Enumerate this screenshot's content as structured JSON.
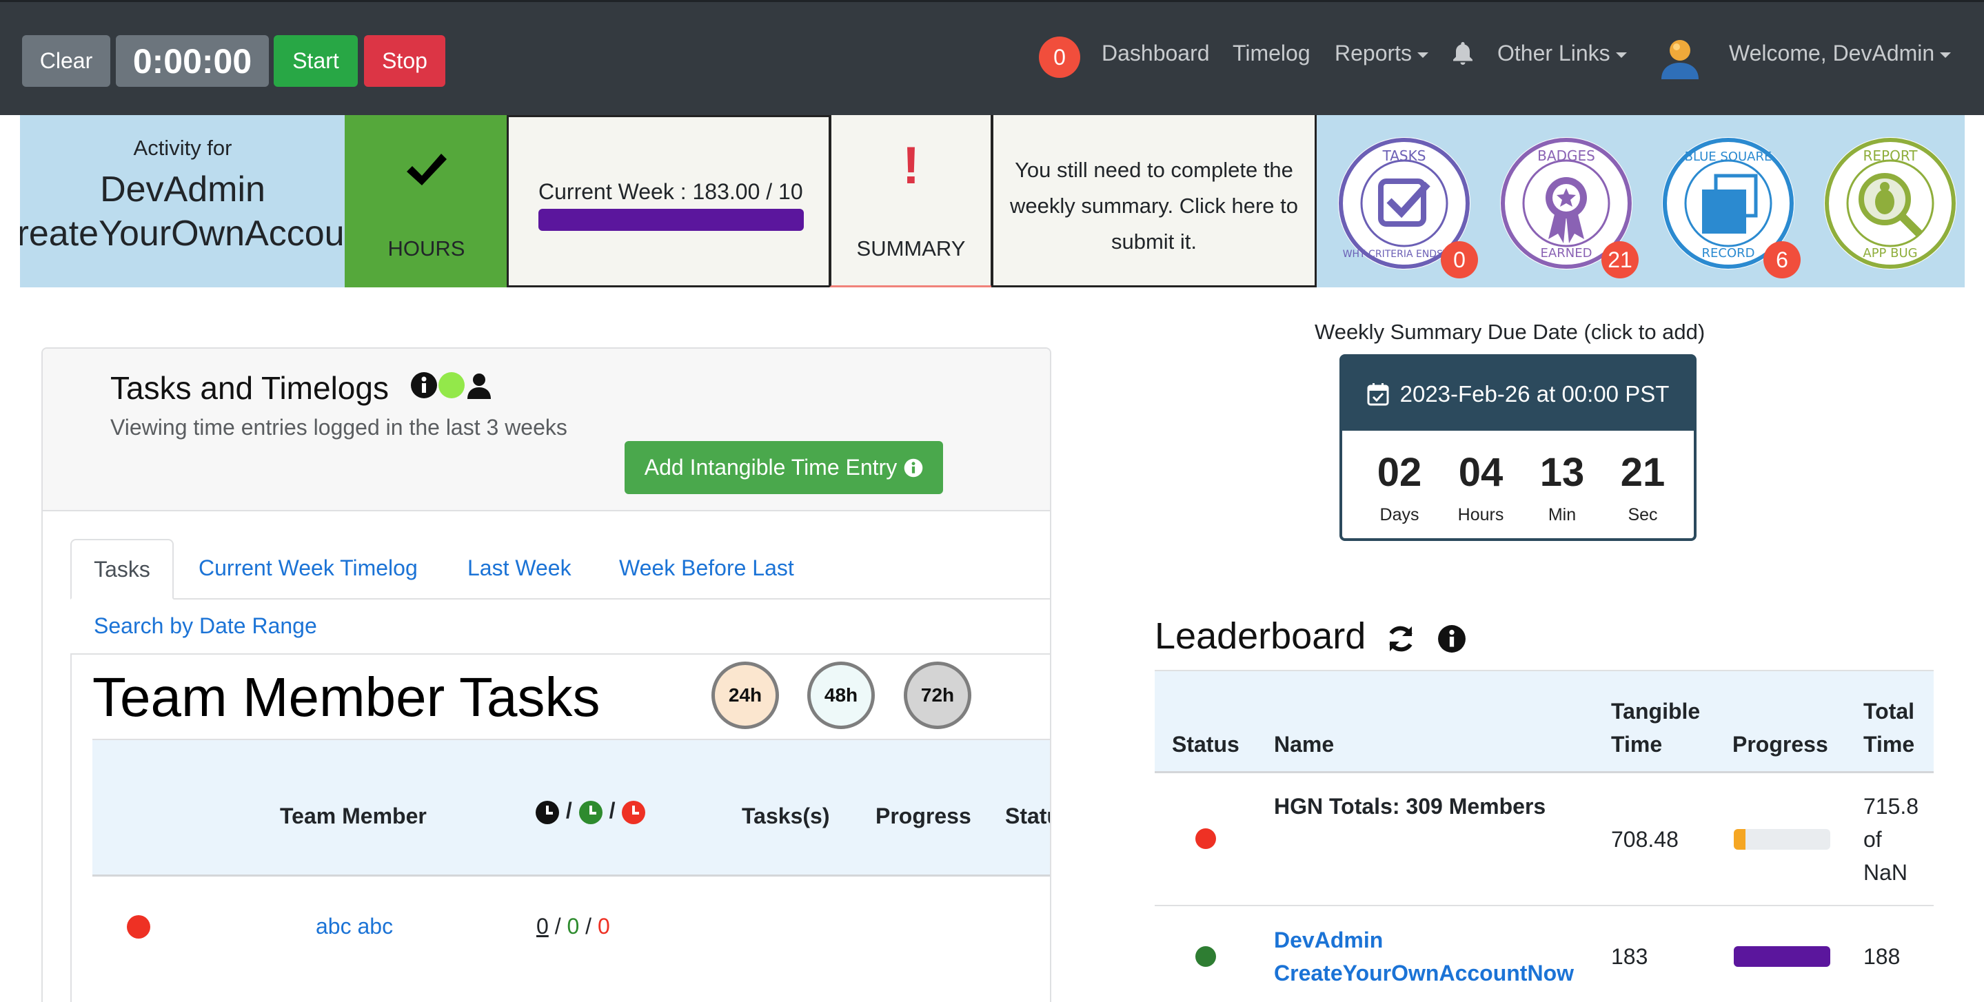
{
  "navbar": {
    "clear_label": "Clear",
    "timer": "0:00:00",
    "start_label": "Start",
    "stop_label": "Stop",
    "notification_count": "0",
    "links": {
      "dashboard": "Dashboard",
      "timelog": "Timelog",
      "reports": "Reports",
      "other_links": "Other Links",
      "welcome": "Welcome, DevAdmin"
    }
  },
  "activity": {
    "label": "Activity for",
    "name_line1": "DevAdmin",
    "name_line2": "CreateYourOwnAccount",
    "hours_label": "HOURS",
    "current_week": "Current Week : 183.00 / 10",
    "summary_label": "SUMMARY",
    "summary_message": "You still need to complete the weekly summary. Click here to submit it."
  },
  "badges": [
    {
      "top_text": "TASKS",
      "bottom_text": "WHY CRITERIA ENDSTATE",
      "count": "0",
      "color": "#6b5fb5"
    },
    {
      "top_text": "BADGES",
      "bottom_text": "EARNED",
      "count": "21",
      "color": "#8a62b4"
    },
    {
      "top_text": "BLUE SQUARE",
      "bottom_text": "RECORD",
      "count": "6",
      "color": "#2b8ad0"
    },
    {
      "top_text": "REPORT",
      "bottom_text": "APP BUG",
      "count": "",
      "color": "#8fae3c"
    }
  ],
  "tasks": {
    "title": "Tasks and Timelogs",
    "subtitle": "Viewing time entries logged in the last 3 weeks",
    "add_button": "Add Intangible Time Entry",
    "tabs": [
      "Tasks",
      "Current Week Timelog",
      "Last Week",
      "Week Before Last",
      "Search by Date Range"
    ],
    "team_title": "Team Member Tasks",
    "time_filters": [
      "24h",
      "48h",
      "72h"
    ],
    "columns": [
      "Team Member",
      "Tasks(s)",
      "Progress",
      "Status"
    ],
    "rows": [
      {
        "name": "abc abc",
        "hours_total": "0",
        "hours_tangible": "0",
        "hours_remaining": "0",
        "status_color": "#ee3124"
      }
    ]
  },
  "due_date": {
    "label": "Weekly Summary Due Date (click to add)",
    "date": "2023-Feb-26 at 00:00 PST",
    "countdown": [
      {
        "value": "02",
        "unit": "Days"
      },
      {
        "value": "04",
        "unit": "Hours"
      },
      {
        "value": "13",
        "unit": "Min"
      },
      {
        "value": "21",
        "unit": "Sec"
      }
    ]
  },
  "leaderboard": {
    "title": "Leaderboard",
    "columns": {
      "status": "Status",
      "name": "Name",
      "tangible": [
        "Tangible",
        "Time"
      ],
      "progress": "Progress",
      "total": [
        "Total",
        "Time"
      ]
    },
    "rows": [
      {
        "name": "HGN Totals: 309 Members",
        "tangible": "708.48",
        "total_lines": [
          "715.8",
          "of",
          "NaN"
        ],
        "progress": 0.12,
        "bar_color": "#f5a623",
        "status_color": "#ee3124"
      },
      {
        "name_lines": [
          "DevAdmin",
          "CreateYourOwnAccountNow"
        ],
        "tangible": "183",
        "total": "188",
        "progress": 1.0,
        "bar_color": "#5b169d",
        "status_color": "#2e7d32"
      }
    ]
  }
}
